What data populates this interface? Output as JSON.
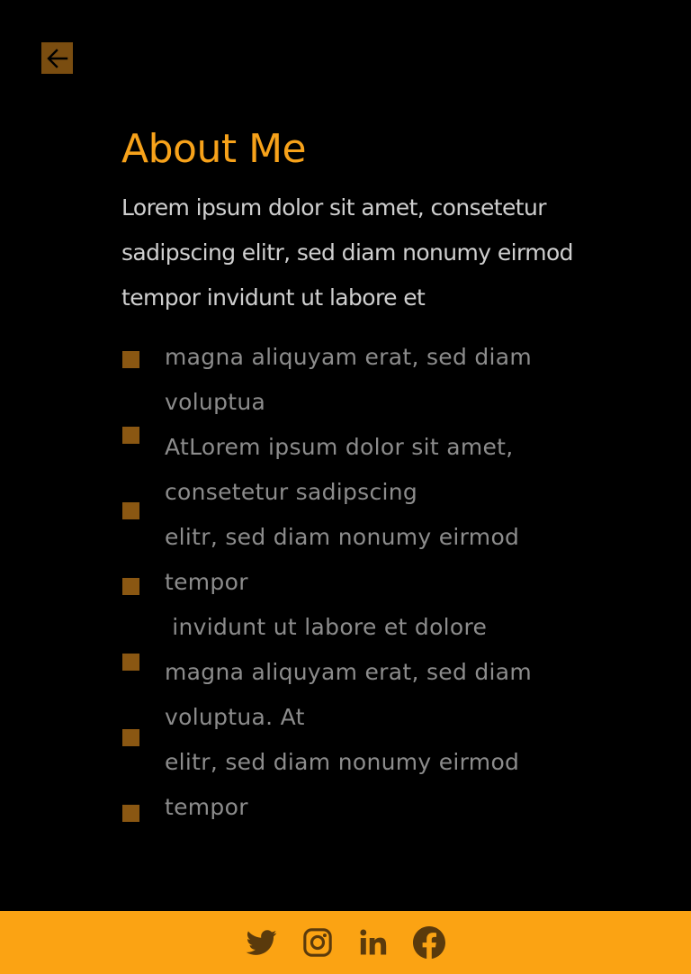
{
  "header": {
    "back_icon": "arrow-left-icon"
  },
  "about": {
    "title": "About Me",
    "intro": "Lorem ipsum dolor sit amet, consetetur sadipscing elitr, sed diam nonumy eirmod tempor invidunt ut labore et"
  },
  "list": {
    "lines": [
      "magna aliquyam erat, sed diam",
      "voluptua",
      "AtLorem ipsum dolor sit amet,",
      "consetetur sadipscing",
      "elitr, sed diam nonumy eirmod",
      "tempor",
      " invidunt ut labore et dolore",
      "magna aliquyam erat, sed diam",
      "voluptua. At",
      "elitr, sed diam nonumy eirmod",
      "tempor"
    ],
    "marker_count": 7
  },
  "footer": {
    "links": [
      {
        "icon": "twitter-icon"
      },
      {
        "icon": "instagram-icon"
      },
      {
        "icon": "linkedin-icon"
      },
      {
        "icon": "facebook-icon"
      }
    ]
  },
  "colors": {
    "background": "#000000",
    "accent": "#f7a21a",
    "footer": "#fba313",
    "marker": "#8a5712",
    "body_text": "#cfcfcf",
    "list_text": "#8c8c8c"
  }
}
